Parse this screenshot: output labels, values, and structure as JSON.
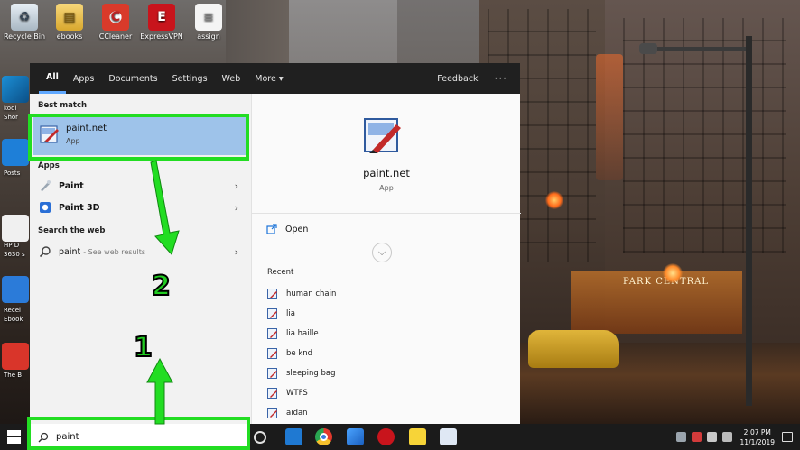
{
  "desktop": {
    "icons": [
      {
        "label": "Recycle Bin",
        "icon": "recycle-bin-icon",
        "glyph": "♻"
      },
      {
        "label": "ebooks",
        "icon": "folder-icon",
        "glyph": "▤"
      },
      {
        "label": "CCleaner",
        "icon": "ccleaner-icon",
        "glyph": "C"
      },
      {
        "label": "ExpressVPN",
        "icon": "expressvpn-icon",
        "glyph": "E"
      },
      {
        "label": "assign",
        "icon": "document-icon",
        "glyph": "≡"
      }
    ],
    "side_labels": [
      "kodi",
      "Shor",
      "Posts",
      "HP D",
      "3630 s",
      "Recei",
      "Ebook",
      "The B"
    ],
    "storefront_sign": "PARK CENTRAL"
  },
  "start_menu": {
    "tabs": [
      "All",
      "Apps",
      "Documents",
      "Settings",
      "Web",
      "More ▾"
    ],
    "active_tab": "All",
    "feedback_label": "Feedback",
    "more_options": "···",
    "best_match": {
      "section_label": "Best match",
      "title": "paint.net",
      "subtitle": "App"
    },
    "apps": {
      "section_label": "Apps",
      "items": [
        {
          "label": "Paint"
        },
        {
          "label": "Paint 3D"
        }
      ]
    },
    "web": {
      "section_label": "Search the web",
      "query": "paint",
      "suffix": "- See web results"
    },
    "chevron": "›",
    "preview": {
      "title": "paint.net",
      "subtitle": "App",
      "open_label": "Open",
      "expand_glyph": "⌵",
      "recent_label": "Recent",
      "recent": [
        "human chain",
        "lia",
        "lia haille",
        "be knd",
        "sleeping bag",
        "WTFS",
        "aidan"
      ]
    }
  },
  "search": {
    "value": "paint",
    "placeholder": ""
  },
  "taskbar": {
    "time": "2:07 PM",
    "date": "11/1/2019"
  },
  "annotations": {
    "step_one": "1",
    "step_two": "2",
    "color": "#22dd22"
  }
}
